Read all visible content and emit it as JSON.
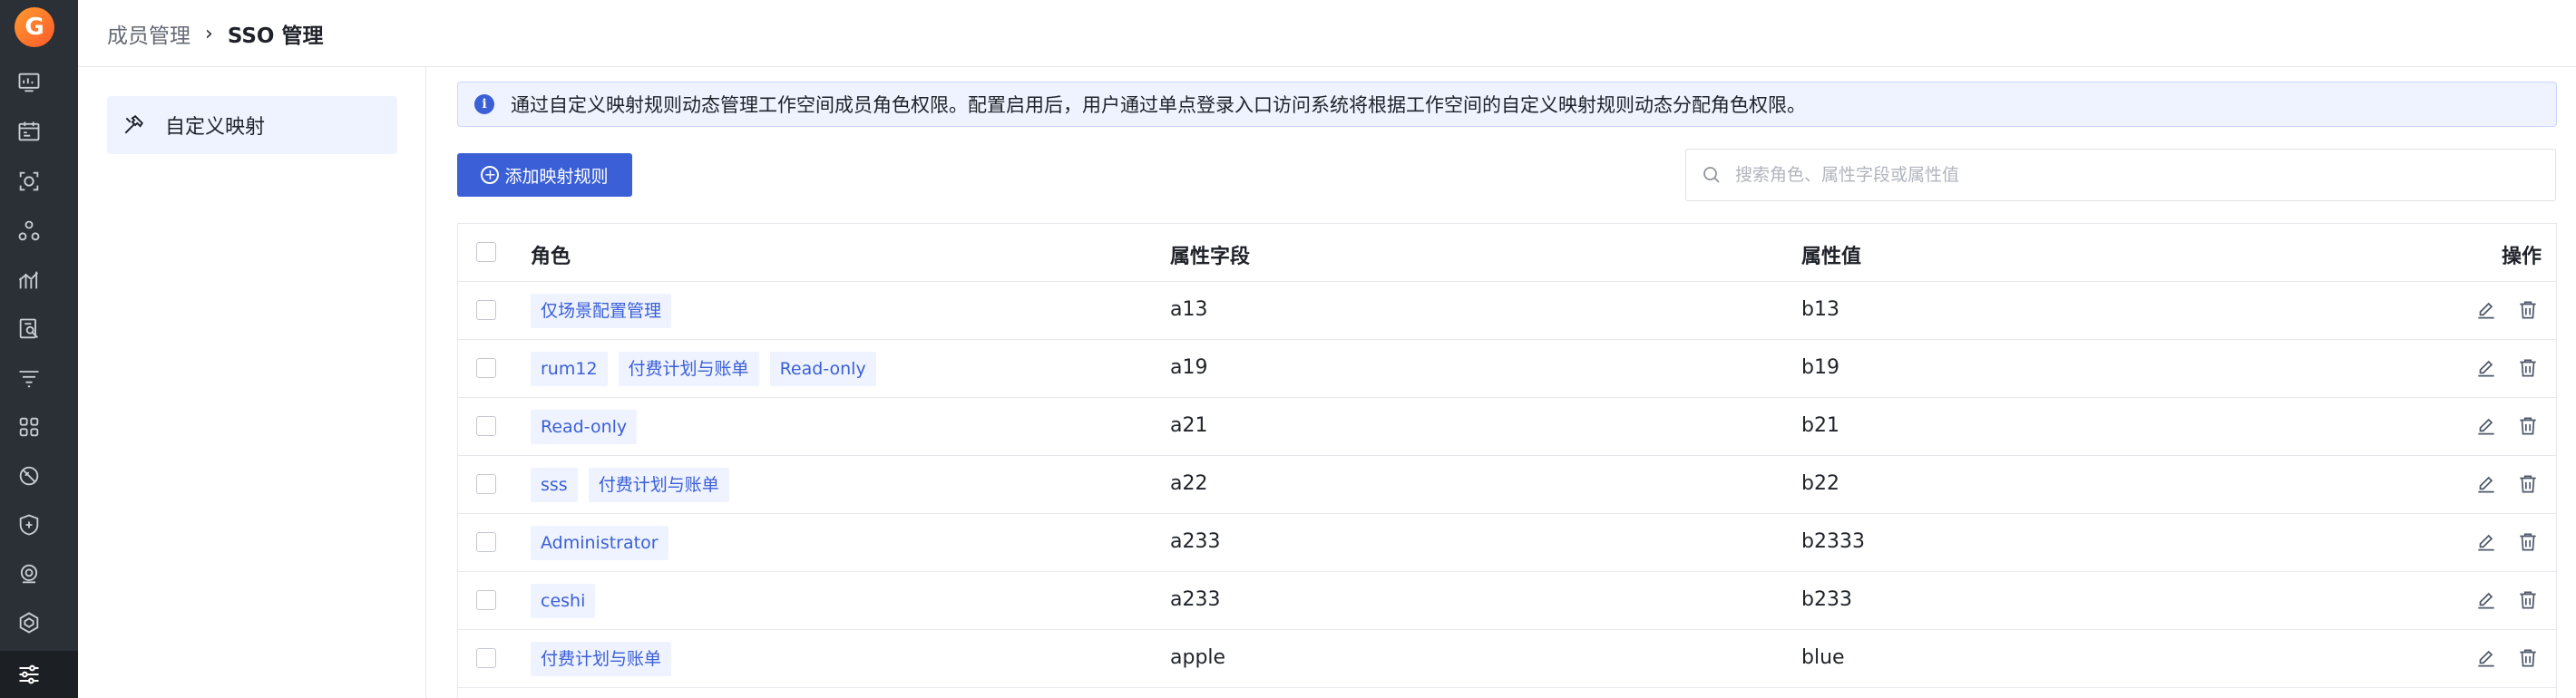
{
  "app": {
    "logo_letter": "G",
    "accent": "#3b5fd6",
    "rail_icons": [
      "dashboard-icon",
      "calendar-icon",
      "scan-icon",
      "cluster-icon",
      "chart-icon",
      "log-search-icon",
      "filter-list-icon",
      "apps-grid-icon",
      "shield-slash-icon",
      "security-shield-icon",
      "monitor-icon",
      "hexagon-icon",
      "settings-sliders-icon"
    ]
  },
  "breadcrumb": {
    "parent": "成员管理",
    "separator": "›",
    "current": "SSO 管理"
  },
  "subnav": {
    "items": [
      {
        "label": "自定义映射",
        "icon": "hammer-icon",
        "active": true
      }
    ]
  },
  "banner": {
    "text": "通过自定义映射规则动态管理工作空间成员角色权限。配置启用后，用户通过单点登录入口访问系统将根据工作空间的自定义映射规则动态分配角色权限。"
  },
  "toolbar": {
    "add_label": "添加映射规则",
    "search_placeholder": "搜索角色、属性字段或属性值",
    "search_value": ""
  },
  "table": {
    "columns": {
      "role": "角色",
      "field": "属性字段",
      "value": "属性值",
      "actions": "操作"
    },
    "rows": [
      {
        "roles": [
          "仅场景配置管理"
        ],
        "field": "a13",
        "value": "b13"
      },
      {
        "roles": [
          "rum12",
          "付费计划与账单",
          "Read-only"
        ],
        "field": "a19",
        "value": "b19"
      },
      {
        "roles": [
          "Read-only"
        ],
        "field": "a21",
        "value": "b21"
      },
      {
        "roles": [
          "sss",
          "付费计划与账单"
        ],
        "field": "a22",
        "value": "b22"
      },
      {
        "roles": [
          "Administrator"
        ],
        "field": "a233",
        "value": "b2333"
      },
      {
        "roles": [
          "ceshi"
        ],
        "field": "a233",
        "value": "b233"
      },
      {
        "roles": [
          "付费计划与账单"
        ],
        "field": "apple",
        "value": "blue"
      }
    ]
  }
}
